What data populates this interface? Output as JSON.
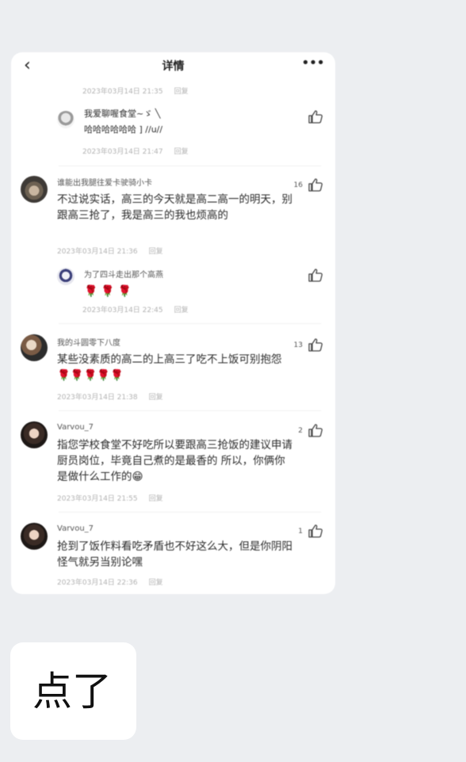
{
  "header": {
    "title": "详情",
    "back_icon": "chevron-left-icon",
    "more_icon": "more-icon"
  },
  "colors": {
    "background": "#eceef1",
    "card": "#ffffff",
    "rose": "#e21f2b"
  },
  "reply_label": "回复",
  "comments": [
    {
      "meta_time": "2023年03月14日 21:35"
    },
    {
      "text": "我爱聊喔食堂~ゞ ╲\n哈哈哈哈哈哈 ] //u//",
      "meta_time": "2023年03月14日 21:47"
    },
    {
      "name": "谁能出我腿往爱卡驶骑小卡",
      "likes": "16",
      "text": "不过说实话，高三的今天就是高二高一的明天，别跟高三抢了，我是高三的我也烦高的",
      "meta_time": "2023年03月14日 21:36"
    },
    {
      "name": "为了四斗走出那个高燕",
      "text": "🌹🌹🌹",
      "meta_time": "2023年03月14日 22:45"
    },
    {
      "name": "我的斗圆零下八度",
      "likes": "13",
      "text": "某些没素质的高二的上高三了吃不上饭可别抱怨🌹🌹🌹🌹🌹",
      "meta_time": "2023年03月14日 21:38"
    },
    {
      "name": "Varvou_7",
      "likes": "2",
      "text": "指您学校食堂不好吃所以要跟高三抢饭的建议申请厨员岗位，毕竟自己煮的是最香的 所以，你俩你是做什么工作的😁",
      "meta_time": "2023年03月14日 21:55"
    },
    {
      "name": "Varvou_7",
      "likes": "1",
      "text": "抢到了饭作料看吃矛盾也不好这么大，但是你阴阳怪气就另当别论嘿",
      "meta_time": "2023年03月14日 22:36"
    }
  ],
  "message": {
    "text": "点了"
  }
}
